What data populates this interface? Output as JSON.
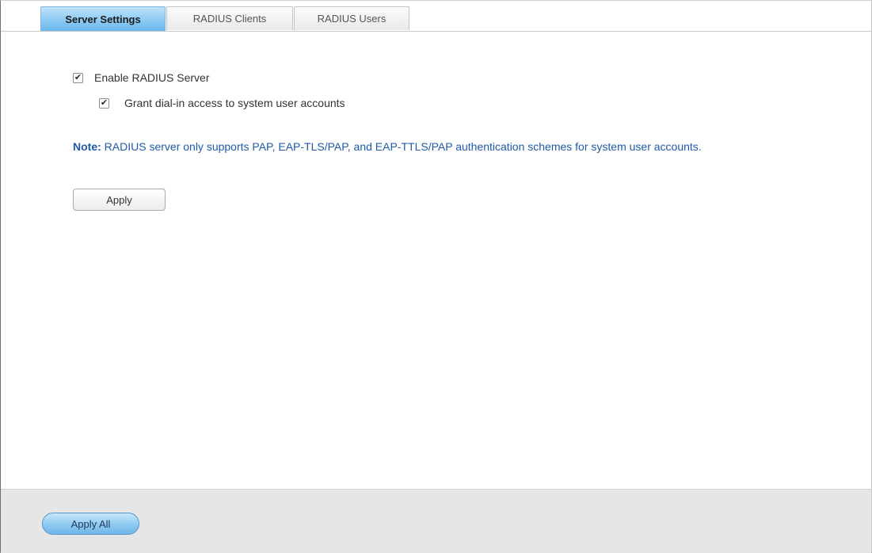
{
  "tabs": [
    {
      "label": "Server Settings",
      "active": true
    },
    {
      "label": "RADIUS Clients",
      "active": false
    },
    {
      "label": "RADIUS Users",
      "active": false
    }
  ],
  "settings": {
    "enable_radius": {
      "label": "Enable RADIUS Server",
      "checked": true
    },
    "grant_dialin": {
      "label": "Grant dial-in access to system user accounts",
      "checked": true
    }
  },
  "note": {
    "prefix": "Note:",
    "text": " RADIUS server only supports PAP, EAP-TLS/PAP, and EAP-TTLS/PAP authentication schemes for system user accounts."
  },
  "buttons": {
    "apply": "Apply",
    "apply_all": "Apply All"
  },
  "colors": {
    "accent": "#8ccaf3",
    "note_text": "#1f5aa8",
    "footer_bg": "#e6e6e6"
  }
}
